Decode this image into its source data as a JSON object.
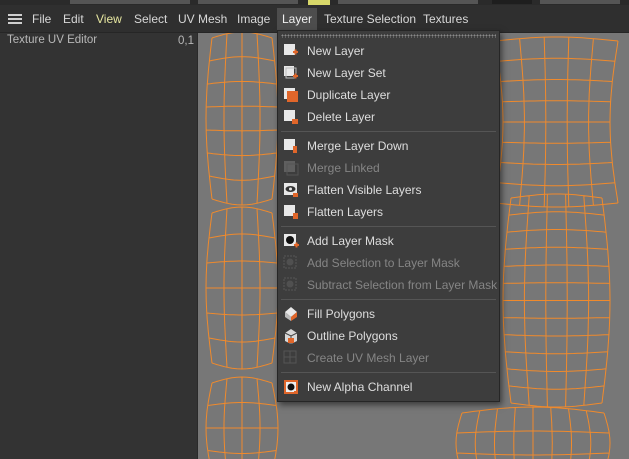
{
  "menubar": {
    "items": [
      "File",
      "Edit",
      "View",
      "Select",
      "UV Mesh",
      "Image",
      "Layer",
      "Texture Selection",
      "Textures"
    ],
    "active": "Layer"
  },
  "panel": {
    "title": "Texture UV Editor",
    "coord": "0,1"
  },
  "layer_menu": {
    "groups": [
      [
        {
          "label": "New Layer",
          "icon": "new-layer-icon",
          "enabled": true
        },
        {
          "label": "New Layer Set",
          "icon": "new-layer-set-icon",
          "enabled": true
        },
        {
          "label": "Duplicate Layer",
          "icon": "duplicate-layer-icon",
          "enabled": true
        },
        {
          "label": "Delete Layer",
          "icon": "delete-layer-icon",
          "enabled": true
        }
      ],
      [
        {
          "label": "Merge Layer Down",
          "icon": "merge-layer-down-icon",
          "enabled": true
        },
        {
          "label": "Merge Linked",
          "icon": "merge-linked-icon",
          "enabled": false
        },
        {
          "label": "Flatten Visible Layers",
          "icon": "flatten-visible-layers-icon",
          "enabled": true
        },
        {
          "label": "Flatten Layers",
          "icon": "flatten-layers-icon",
          "enabled": true
        }
      ],
      [
        {
          "label": "Add Layer Mask",
          "icon": "add-layer-mask-icon",
          "enabled": true
        },
        {
          "label": "Add Selection to Layer Mask",
          "icon": "add-selection-to-mask-icon",
          "enabled": false
        },
        {
          "label": "Subtract Selection from Layer Mask",
          "icon": "subtract-selection-from-mask-icon",
          "enabled": false
        }
      ],
      [
        {
          "label": "Fill Polygons",
          "icon": "fill-polygons-icon",
          "enabled": true
        },
        {
          "label": "Outline Polygons",
          "icon": "outline-polygons-icon",
          "enabled": true
        },
        {
          "label": "Create UV Mesh Layer",
          "icon": "create-uv-mesh-layer-icon",
          "enabled": false
        }
      ],
      [
        {
          "label": "New Alpha Channel",
          "icon": "new-alpha-channel-icon",
          "enabled": true
        }
      ]
    ]
  },
  "colors": {
    "uv_wire": "#f08a2c",
    "viewport_bg": "#777777",
    "menu_bg": "#3d3d3d",
    "accent_orange": "#e0662a"
  }
}
